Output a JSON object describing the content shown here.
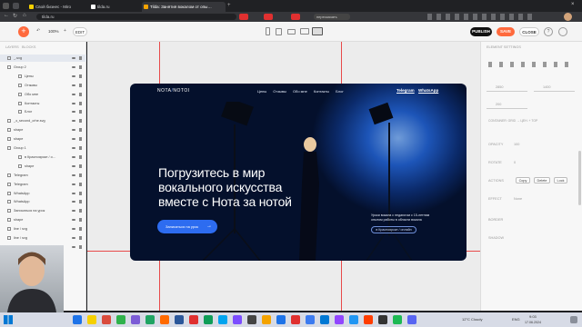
{
  "browser": {
    "tabs": [
      {
        "label": "Свой бизнес - Miro",
        "color": "#f5d000"
      },
      {
        "label": "tilda.ru",
        "color": "#ffffff"
      },
      {
        "label": "Tilda: Занятия вокалом от опы…",
        "color": "#f4a300"
      },
      {
        "label": "",
        "color": "#e03030"
      },
      {
        "label": "",
        "color": "#e03030"
      },
      {
        "label": "",
        "color": "#e03030"
      },
      {
        "label": "пересказать",
        "color": "#3c7bf0"
      }
    ],
    "url": "tilda.ru"
  },
  "toolbar": {
    "zoom": "100%",
    "edit_label": "EDIT",
    "publish_label": "PUBLISH",
    "save_label": "SAVE",
    "close_label": "CLOSE"
  },
  "layers_panel": {
    "tabs": [
      "LAYERS",
      "BLOCKS"
    ],
    "items": [
      {
        "label": "_.svg",
        "indent": 0
      },
      {
        "label": "Group 2",
        "indent": 0
      },
      {
        "label": "Цены",
        "indent": 2
      },
      {
        "label": "Отзывы",
        "indent": 2
      },
      {
        "label": "Обо мне",
        "indent": 2
      },
      {
        "label": "Контакты",
        "indent": 2
      },
      {
        "label": "Блог",
        "indent": 2
      },
      {
        "label": "_з_second_crhe.svg",
        "indent": 0
      },
      {
        "label": "shape",
        "indent": 0
      },
      {
        "label": "shape",
        "indent": 0
      },
      {
        "label": "Group 1",
        "indent": 0
      },
      {
        "label": "в Красноярске / о…",
        "indent": 2
      },
      {
        "label": "shape",
        "indent": 2
      },
      {
        "label": "Telegram",
        "indent": 0
      },
      {
        "label": "Telegram",
        "indent": 0
      },
      {
        "label": "WhatsApp",
        "indent": 0
      },
      {
        "label": "WhatsApp",
        "indent": 0
      },
      {
        "label": "Записаться на урок",
        "indent": 0
      },
      {
        "label": "shape",
        "indent": 0
      },
      {
        "label": "line / svg",
        "indent": 0
      },
      {
        "label": "line / svg",
        "indent": 0
      },
      {
        "label": "Уроки вокала в к…",
        "indent": 0
      }
    ]
  },
  "site": {
    "logo_left": "NOTA",
    "logo_right": "NOTOI",
    "nav": [
      "Цены",
      "Отзывы",
      "Обо мне",
      "Контакты",
      "Блог"
    ],
    "telegram": "Telegram",
    "whatsapp": "WhatsApp",
    "headline": [
      "Погрузитесь в мир",
      "вокального искусства",
      "вместе с Нота за нотой"
    ],
    "cta_label": "Записаться на урок",
    "cta_arrow": "→",
    "side_text": "Уроки вокала с педагогом с 15-летним опытом работы в области вокала",
    "location_badge": "в Красноярске / онлайн"
  },
  "properties": {
    "heading": "ELEMENT SETTINGS",
    "x": "2850",
    "y": "1400",
    "w": "200",
    "container_note": "CONTAINER: GRID → ЦЕН. + TOP",
    "opacity_label": "OPACITY",
    "opacity_value": "100",
    "rotate_label": "ROTATE",
    "rotate_value": "0",
    "actions_label": "ACTIONS",
    "copy_label": "Copy",
    "delete_label": "Delete",
    "lock_label": "Lock",
    "effect_label": "EFFECT",
    "effect_value": "None",
    "border_label": "BORDER",
    "shadow_label": "SHADOW"
  },
  "taskbar": {
    "weather": "12°C  Cloudy",
    "lang": "ENG",
    "time": "9:03",
    "date": "17.06.2024",
    "icon_colors": [
      "#1e73e8",
      "#f5d000",
      "#d94b3d",
      "#2fb24c",
      "#7b5cd6",
      "#1fa463",
      "#ff6a00",
      "#2b579a",
      "#e03030",
      "#0f9d58",
      "#00a4ef",
      "#7c4dff",
      "#444444",
      "#f4a300",
      "#1e73e8",
      "#e03030",
      "#3c7bf0",
      "#0078d4",
      "#9146ff",
      "#2196f3",
      "#ff3d00",
      "#333333",
      "#1db954",
      "#5865f2"
    ]
  }
}
